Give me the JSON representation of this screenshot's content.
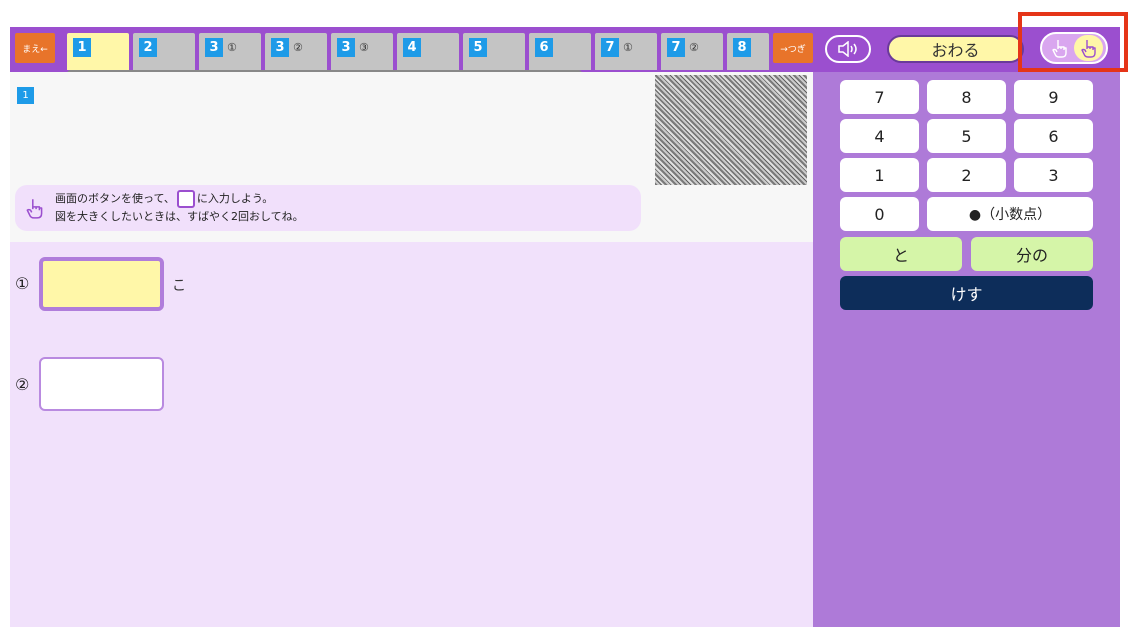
{
  "nav": {
    "prev_label": "まえ←",
    "next_label": "→つぎ",
    "tabs": [
      {
        "num": "1",
        "sub": ""
      },
      {
        "num": "2",
        "sub": ""
      },
      {
        "num": "3",
        "sub": "①"
      },
      {
        "num": "3",
        "sub": "②"
      },
      {
        "num": "3",
        "sub": "③"
      },
      {
        "num": "4",
        "sub": ""
      },
      {
        "num": "5",
        "sub": ""
      },
      {
        "num": "6",
        "sub": ""
      },
      {
        "num": "7",
        "sub": "①"
      },
      {
        "num": "7",
        "sub": "②"
      },
      {
        "num": "8",
        "sub": ""
      }
    ],
    "sound_icon": "speaker-icon",
    "end_label": "おわる",
    "mode_icons": [
      "pointing-hand-icon",
      "tap-hand-icon"
    ]
  },
  "question": {
    "badge": "1",
    "hint_line1_a": "画面のボタンを使って、",
    "hint_line1_b": "に入力しよう。",
    "hint_line2": "図を大きくしたいときは、すばやく2回おしてね。"
  },
  "answers": [
    {
      "label": "①",
      "unit": "こ",
      "value": ""
    },
    {
      "label": "②",
      "unit": "",
      "value": ""
    }
  ],
  "keypad": {
    "k7": "7",
    "k8": "8",
    "k9": "9",
    "k4": "4",
    "k5": "5",
    "k6": "6",
    "k1": "1",
    "k2": "2",
    "k3": "3",
    "k0": "0",
    "kdot": "●（小数点）",
    "kto": "と",
    "kbunno": "分の",
    "kclear": "けす"
  },
  "colors": {
    "accent": "#9b4fcf",
    "keypad_bg": "#ae7ad8",
    "tab_active": "#fff7a8",
    "tab_num": "#1e9be8",
    "nav_button": "#e8742a",
    "highlight": "#e53518"
  }
}
